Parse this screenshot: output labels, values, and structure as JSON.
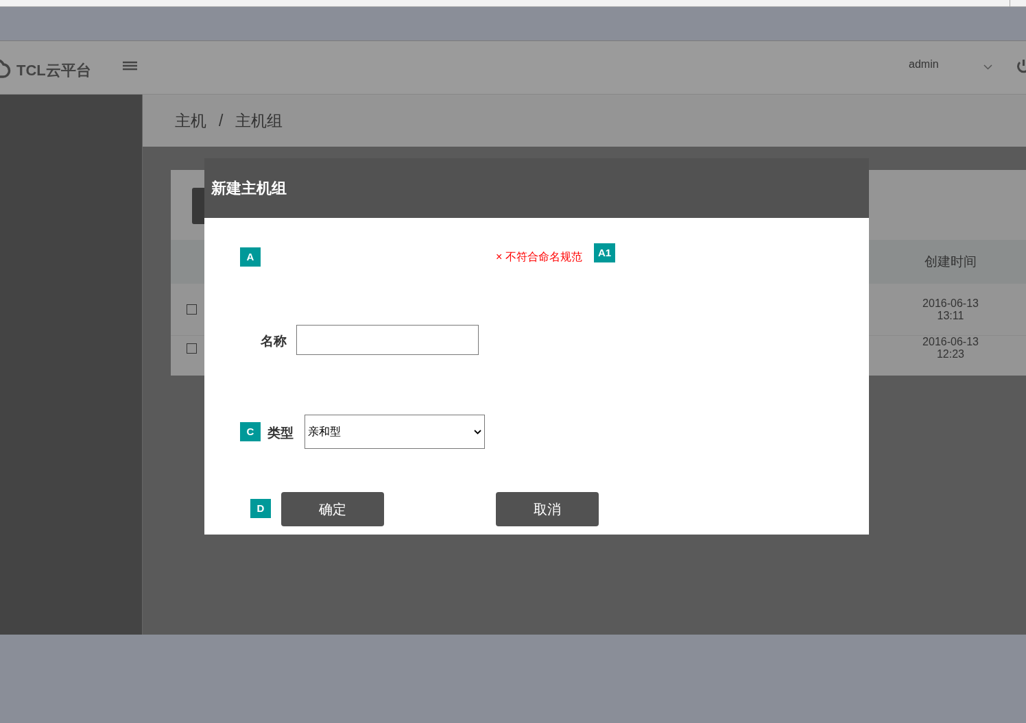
{
  "header": {
    "logo": "TCL云平台",
    "user": "admin"
  },
  "breadcrumb": [
    "主机",
    "主机组"
  ],
  "breadcrumb_separator": "/",
  "table": {
    "columns": [
      "创建时间"
    ],
    "rows": [
      {
        "checked": false,
        "created": "2016-06-13\n13:11"
      },
      {
        "checked": false,
        "created": "2016-06-13\n12:23"
      }
    ]
  },
  "dialog": {
    "title": "新建主机组",
    "error": "× 不符合命名规范",
    "markers": [
      "A",
      "A1",
      "C",
      "D"
    ],
    "name_label": "名称",
    "type_label": "类型",
    "type_value": "亲和型",
    "buttons": [
      "确定",
      "取消"
    ]
  }
}
